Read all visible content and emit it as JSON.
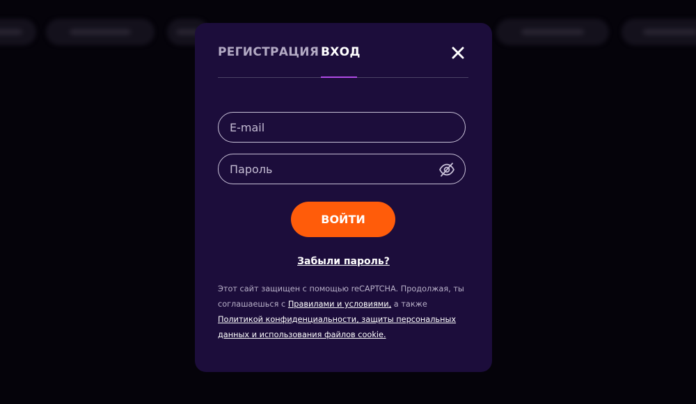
{
  "tabs": {
    "register_label": "РЕГИСТРАЦИЯ",
    "login_label": "ВХОД",
    "active": "login"
  },
  "form": {
    "email_placeholder": "E-mail",
    "email_value": "",
    "password_placeholder": "Пароль",
    "password_value": "",
    "submit_label": "ВОЙТИ",
    "forgot_label": "Забыли пароль?"
  },
  "disclaimer": {
    "text_1": "Этот сайт защищен с помощью reCAPTCHA. Продолжая, ты соглашаешься с ",
    "terms_link": "Правилами и условиями,",
    "text_2": " а также ",
    "privacy_link": "Политикой конфиденциальности, защиты персональных данных и использования файлов cookie."
  },
  "icons": {
    "close": "close-icon",
    "password_toggle": "eye-off-icon"
  },
  "colors": {
    "modal_bg": "#1c0d3b",
    "accent_tab": "#b24be8",
    "submit_bg": "#ff5c0a",
    "page_bg": "#05030a"
  }
}
